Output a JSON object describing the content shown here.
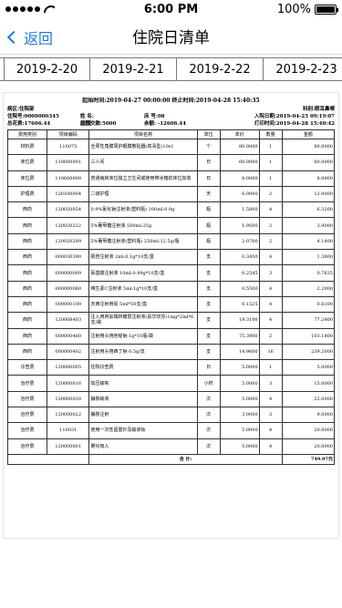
{
  "status_bar": {
    "time": "6:00 PM",
    "battery": "100%",
    "battery_level": 1.0
  },
  "nav": {
    "back_label": "返回",
    "title": "住院日清单"
  },
  "date_tabs": [
    "2019-2-20",
    "2019-2-21",
    "2019-2-22",
    "2019-2-23"
  ],
  "report": {
    "range_text": "起始时间:2019-04-27 00:00:00 终止时间:2019-04-28 15:40:35",
    "ward": "病区:住院部",
    "dept_label": "科别:眼耳鼻喉",
    "inpatient_no": "住院号:0000000345",
    "name_label": "姓 名:",
    "bed": "床 号:08",
    "admit_date": "入院日期:2019-04-25 09:19:07",
    "total_cost": "总花费:17606.44",
    "prepay": "总预交款:5000",
    "balance": "余额: -12606.44",
    "print_time": "打印时间:2019-04-28 15:40:42",
    "columns": [
      "费用类别",
      "项目编码",
      "项目名称",
      "单位",
      "单价",
      "数量",
      "金额"
    ],
    "rows": [
      [
        "材料费",
        "110075",
        "全周性角膜周护眼膜敷贴器(高清型)10s1",
        "个",
        "80.0000",
        "1",
        "80.0000"
      ],
      [
        "床位费",
        "110600001",
        "三人间",
        "日",
        "60.0000",
        "1",
        "60.0000"
      ],
      [
        "床位费",
        "110600000",
        "普通病房床位独立卫生间或使用带冰箱的床位加收",
        "日",
        "8.0000",
        "1",
        "8.0000"
      ],
      [
        "护理费",
        "120100004",
        "二级护理",
        "天",
        "6.0000",
        "2",
        "12.0000"
      ],
      [
        "西药",
        "120020054",
        "0.9%氯化钠注射液(塑料瓶) 100ml:0.9g",
        "瓶",
        "1.5800",
        "4",
        "6.3200"
      ],
      [
        "西药",
        "120020222",
        "5%葡萄糖注射液 500ml:25g",
        "瓶",
        "1.9500",
        "2",
        "3.9000"
      ],
      [
        "西药",
        "120020299",
        "5%葡萄糖注射液(塑料瓶) 250ml:12.5g/瓶",
        "瓶",
        "2.0700",
        "2",
        "4.1400"
      ],
      [
        "西药",
        "000030390",
        "肌苷注射液 2ml:0.1g*10支/盒",
        "支",
        "0.3450",
        "4",
        "1.3800"
      ],
      [
        "西药",
        "000000009",
        "氨基酸注射液 10ml:0.99g*10支/盒",
        "支",
        "0.2545",
        "3",
        "0.7635"
      ],
      [
        "西药",
        "000000060",
        "维生素C注射液 5ml:1g*10支/盒",
        "支",
        "0.5500",
        "4",
        "2.2000"
      ],
      [
        "西药",
        "000000100",
        "天西注射用氨 5ml*50支/盒",
        "支",
        "0.1525",
        "4",
        "0.6100"
      ],
      [
        "西药",
        "120008403",
        "注入用丙氨瑞林镀层注射液(喜华欣芬)1mg*2ml*6支/袋",
        "支",
        "19.3100",
        "4",
        "77.2400"
      ],
      [
        "西药",
        "000000480",
        "注射用头孢他啶钠 1g*10瓶/袋",
        "支",
        "75.3900",
        "2",
        "103.1800"
      ],
      [
        "西药",
        "000000402",
        "注射用头孢西丁钠 0.5g/支",
        "支",
        "14.9600",
        "16",
        "239.2000"
      ],
      [
        "诊查费",
        "120000005",
        "住院诊查费",
        "日",
        "5.0000",
        "1",
        "5.0000"
      ],
      [
        "治疗费",
        "120000016",
        "加压输氧",
        "小时",
        "5.0000",
        "3",
        "15.0000"
      ],
      [
        "治疗费",
        "120000020",
        "静脉输液",
        "次",
        "5.0000",
        "4",
        "22.0000"
      ],
      [
        "治疗费",
        "120000022",
        "静脉注射",
        "次",
        "3.0000",
        "3",
        "9.0000"
      ],
      [
        "治疗费",
        "110031",
        "使用一次性留置针及输液钛",
        "次",
        "5.0000",
        "4",
        "20.0000"
      ],
      [
        "治疗费",
        "120000001",
        "雾化吸入",
        "次",
        "5.0000",
        "4",
        "20.0000"
      ]
    ],
    "total_label": "合 计:",
    "total_value": "749.97元"
  }
}
